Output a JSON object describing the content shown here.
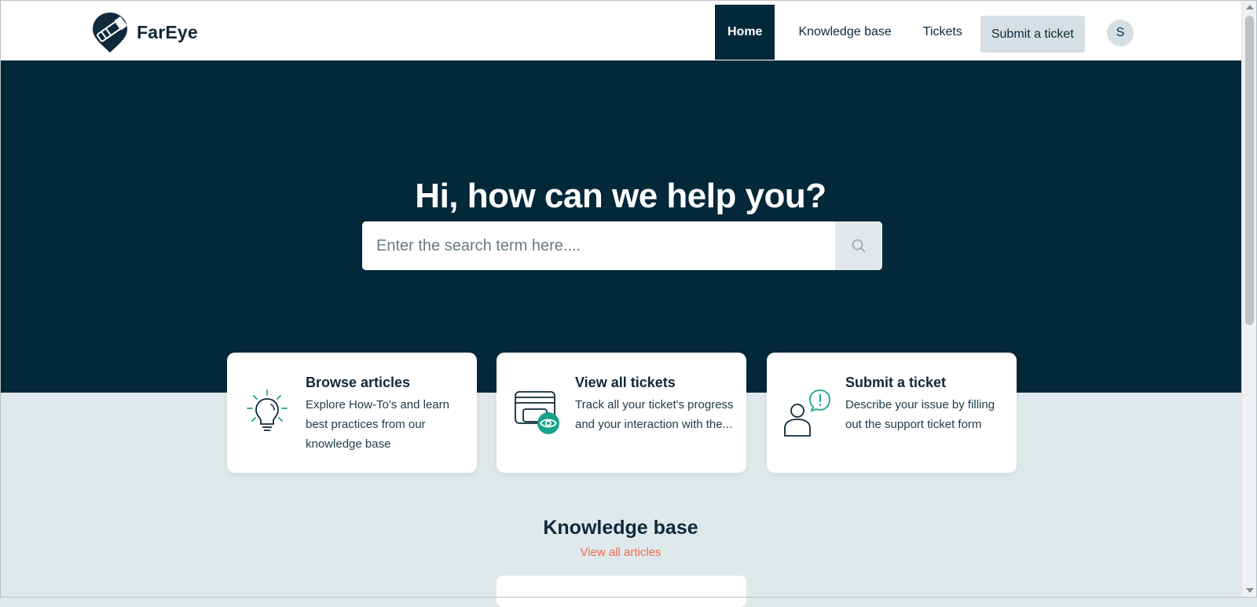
{
  "brand": {
    "name": "FarEye",
    "logo_icon": "fareye-logo-icon"
  },
  "nav": {
    "home": "Home",
    "knowledge_base": "Knowledge base",
    "tickets": "Tickets",
    "submit": "Submit a ticket",
    "avatar_initial": "S"
  },
  "hero": {
    "title": "Hi, how can we help you?",
    "search_placeholder": "Enter the search term here....",
    "search_value": "",
    "search_icon": "search-icon"
  },
  "cards": [
    {
      "title": "Browse articles",
      "description": "Explore How-To's and learn best practices from our knowledge base",
      "icon": "lightbulb-icon"
    },
    {
      "title": "View all tickets",
      "description": "Track all your ticket's progress and your interaction with the...",
      "icon": "tickets-eye-icon"
    },
    {
      "title": "Submit a ticket",
      "description": "Describe your issue by filling out the support ticket form",
      "icon": "person-alert-icon"
    }
  ],
  "knowledge_base": {
    "title": "Knowledge base",
    "link": "View all articles"
  },
  "colors": {
    "dark_navy": "#03283a",
    "light_bg": "#dfe9ec",
    "accent_teal": "#1aa38a",
    "link_coral": "#f06a4f",
    "button_gray": "#d5dfe4"
  }
}
